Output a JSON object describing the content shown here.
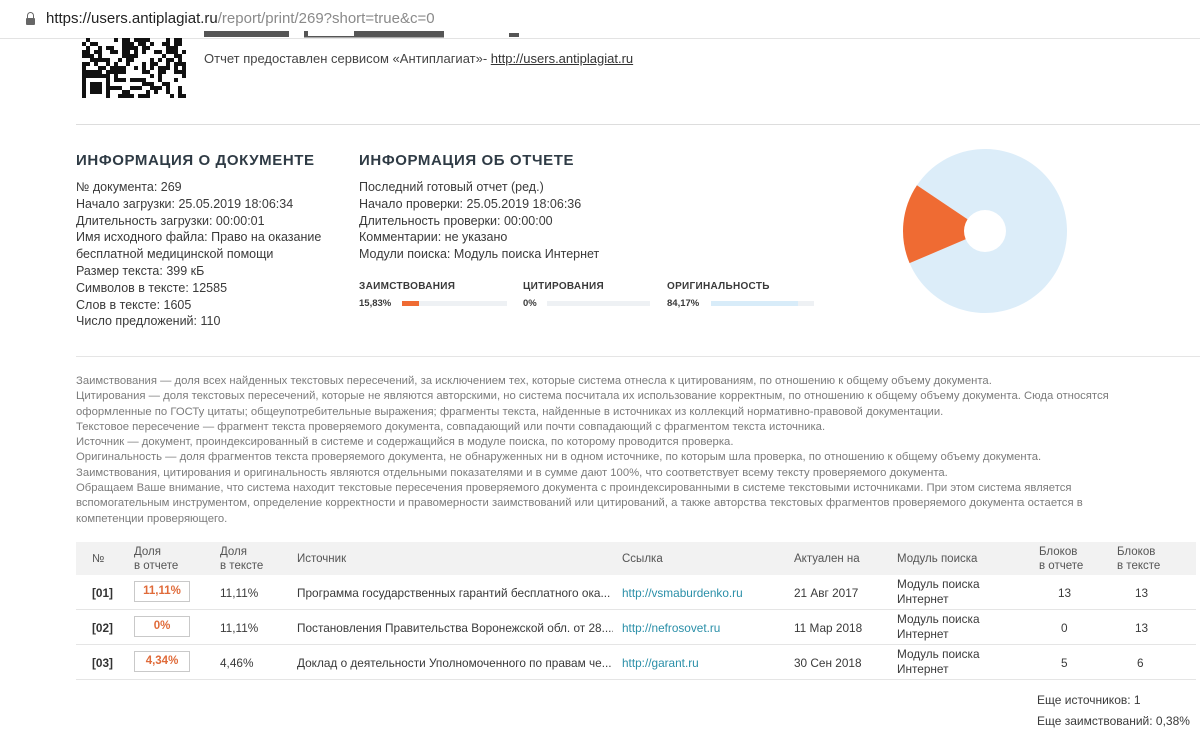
{
  "browser": {
    "url_host": "https://users.antiplagiat.ru",
    "url_path": "/report/print/269?short=true&c=0"
  },
  "header": {
    "provided_text": "Отчет предоставлен сервисом «Антиплагиат»- ",
    "provided_link": "http://users.antiplagiat.ru"
  },
  "doc_info": {
    "title": "ИНФОРМАЦИЯ О ДОКУМЕНТЕ",
    "lines": [
      "№ документа: 269",
      "Начало загрузки: 25.05.2019 18:06:34",
      "Длительность загрузки: 00:00:01",
      "Имя исходного файла: Право на оказание",
      "бесплатной медицинской помощи",
      "Размер текста: 399 кБ",
      "Символов в тексте: 12585",
      "Слов в тексте: 1605",
      "Число предложений: 110"
    ]
  },
  "report_info": {
    "title": "ИНФОРМАЦИЯ ОБ ОТЧЕТЕ",
    "lines": [
      "Последний готовый отчет (ред.)",
      "Начало проверки: 25.05.2019 18:06:36",
      "Длительность проверки: 00:00:00",
      "Комментарии: не указано",
      "Модули поиска: Модуль поиска Интернет"
    ]
  },
  "metrics": [
    {
      "label": "ЗАИМСТВОВАНИЯ",
      "value": "15,83%",
      "fraction": 0.1583,
      "color": "#ef6b33"
    },
    {
      "label": "ЦИТИРОВАНИЯ",
      "value": "0%",
      "fraction": 0,
      "color": "#6fbf4a"
    },
    {
      "label": "ОРИГИНАЛЬНОСТЬ",
      "value": "84,17%",
      "fraction": 0.8417,
      "color": "#d8ecf9"
    }
  ],
  "pie": {
    "borrow_fraction": 0.1583,
    "original_fraction": 0.8417,
    "borrow_color": "#ef6b33",
    "original_color": "#dcedf9"
  },
  "legend_lines": [
    "Заимствования — доля всех найденных текстовых пересечений, за исключением тех, которые система отнесла к цитированиям, по отношению к общему объему документа.",
    "Цитирования — доля текстовых пересечений, которые не являются авторскими, но система посчитала их использование корректным, по отношению к общему объему документа. Сюда относятся",
    "оформленные по ГОСТу цитаты; общеупотребительные выражения; фрагменты текста, найденные в источниках из коллекций нормативно-правовой документации.",
    "Текстовое пересечение — фрагмент текста проверяемого документа, совпадающий или почти совпадающий с фрагментом текста источника.",
    "Источник — документ, проиндексированный в системе и содержащийся в модуле поиска, по которому проводится проверка.",
    "Оригинальность — доля фрагментов текста проверяемого документа, не обнаруженных ни в одном источнике, по которым шла проверка, по отношению к общему объему документа.",
    "Заимствования, цитирования и оригинальность являются отдельными показателями и в сумме дают 100%, что соответствует всему тексту проверяемого документа.",
    "Обращаем Ваше внимание, что система находит текстовые пересечения проверяемого документа с проиндексированными в системе текстовыми источниками. При этом система является",
    "вспомогательным инструментом, определение корректности и правомерности заимствований или цитирований, а также авторства текстовых фрагментов проверяемого документа остается в",
    "компетенции проверяющего."
  ],
  "table": {
    "headers": {
      "num": "№",
      "share_report_1": "Доля",
      "share_report_2": "в отчете",
      "share_text_1": "Доля",
      "share_text_2": "в тексте",
      "source": "Источник",
      "link": "Ссылка",
      "actual": "Актуален на",
      "module": "Модуль поиска",
      "blocks_report_1": "Блоков",
      "blocks_report_2": "в отчете",
      "blocks_text_1": "Блоков",
      "blocks_text_2": "в тексте"
    },
    "rows": [
      {
        "num": "[01]",
        "share_report": "11,11%",
        "share_text": "11,11%",
        "source": "Программа государственных гарантий бесплатного ока...",
        "link": "http://vsmaburdenko.ru",
        "actual": "21 Авг 2017",
        "module": "Модуль поиска Интернет",
        "blocks_report": "13",
        "blocks_text": "13"
      },
      {
        "num": "[02]",
        "share_report": "0%",
        "share_text": "11,11%",
        "source": "Постановления Правительства Воронежской обл. от 28....",
        "link": "http://nefrosovet.ru",
        "actual": "11 Мар 2018",
        "module": "Модуль поиска Интернет",
        "blocks_report": "0",
        "blocks_text": "13"
      },
      {
        "num": "[03]",
        "share_report": "4,34%",
        "share_text": "4,46%",
        "source": "Доклад о деятельности Уполномоченного по правам че...",
        "link": "http://garant.ru",
        "actual": "30 Сен 2018",
        "module": "Модуль поиска Интернет",
        "blocks_report": "5",
        "blocks_text": "6"
      }
    ]
  },
  "footer": {
    "more_sources": "Еще источников: 1",
    "more_borrow": "Еще заимствований: 0,38%"
  }
}
